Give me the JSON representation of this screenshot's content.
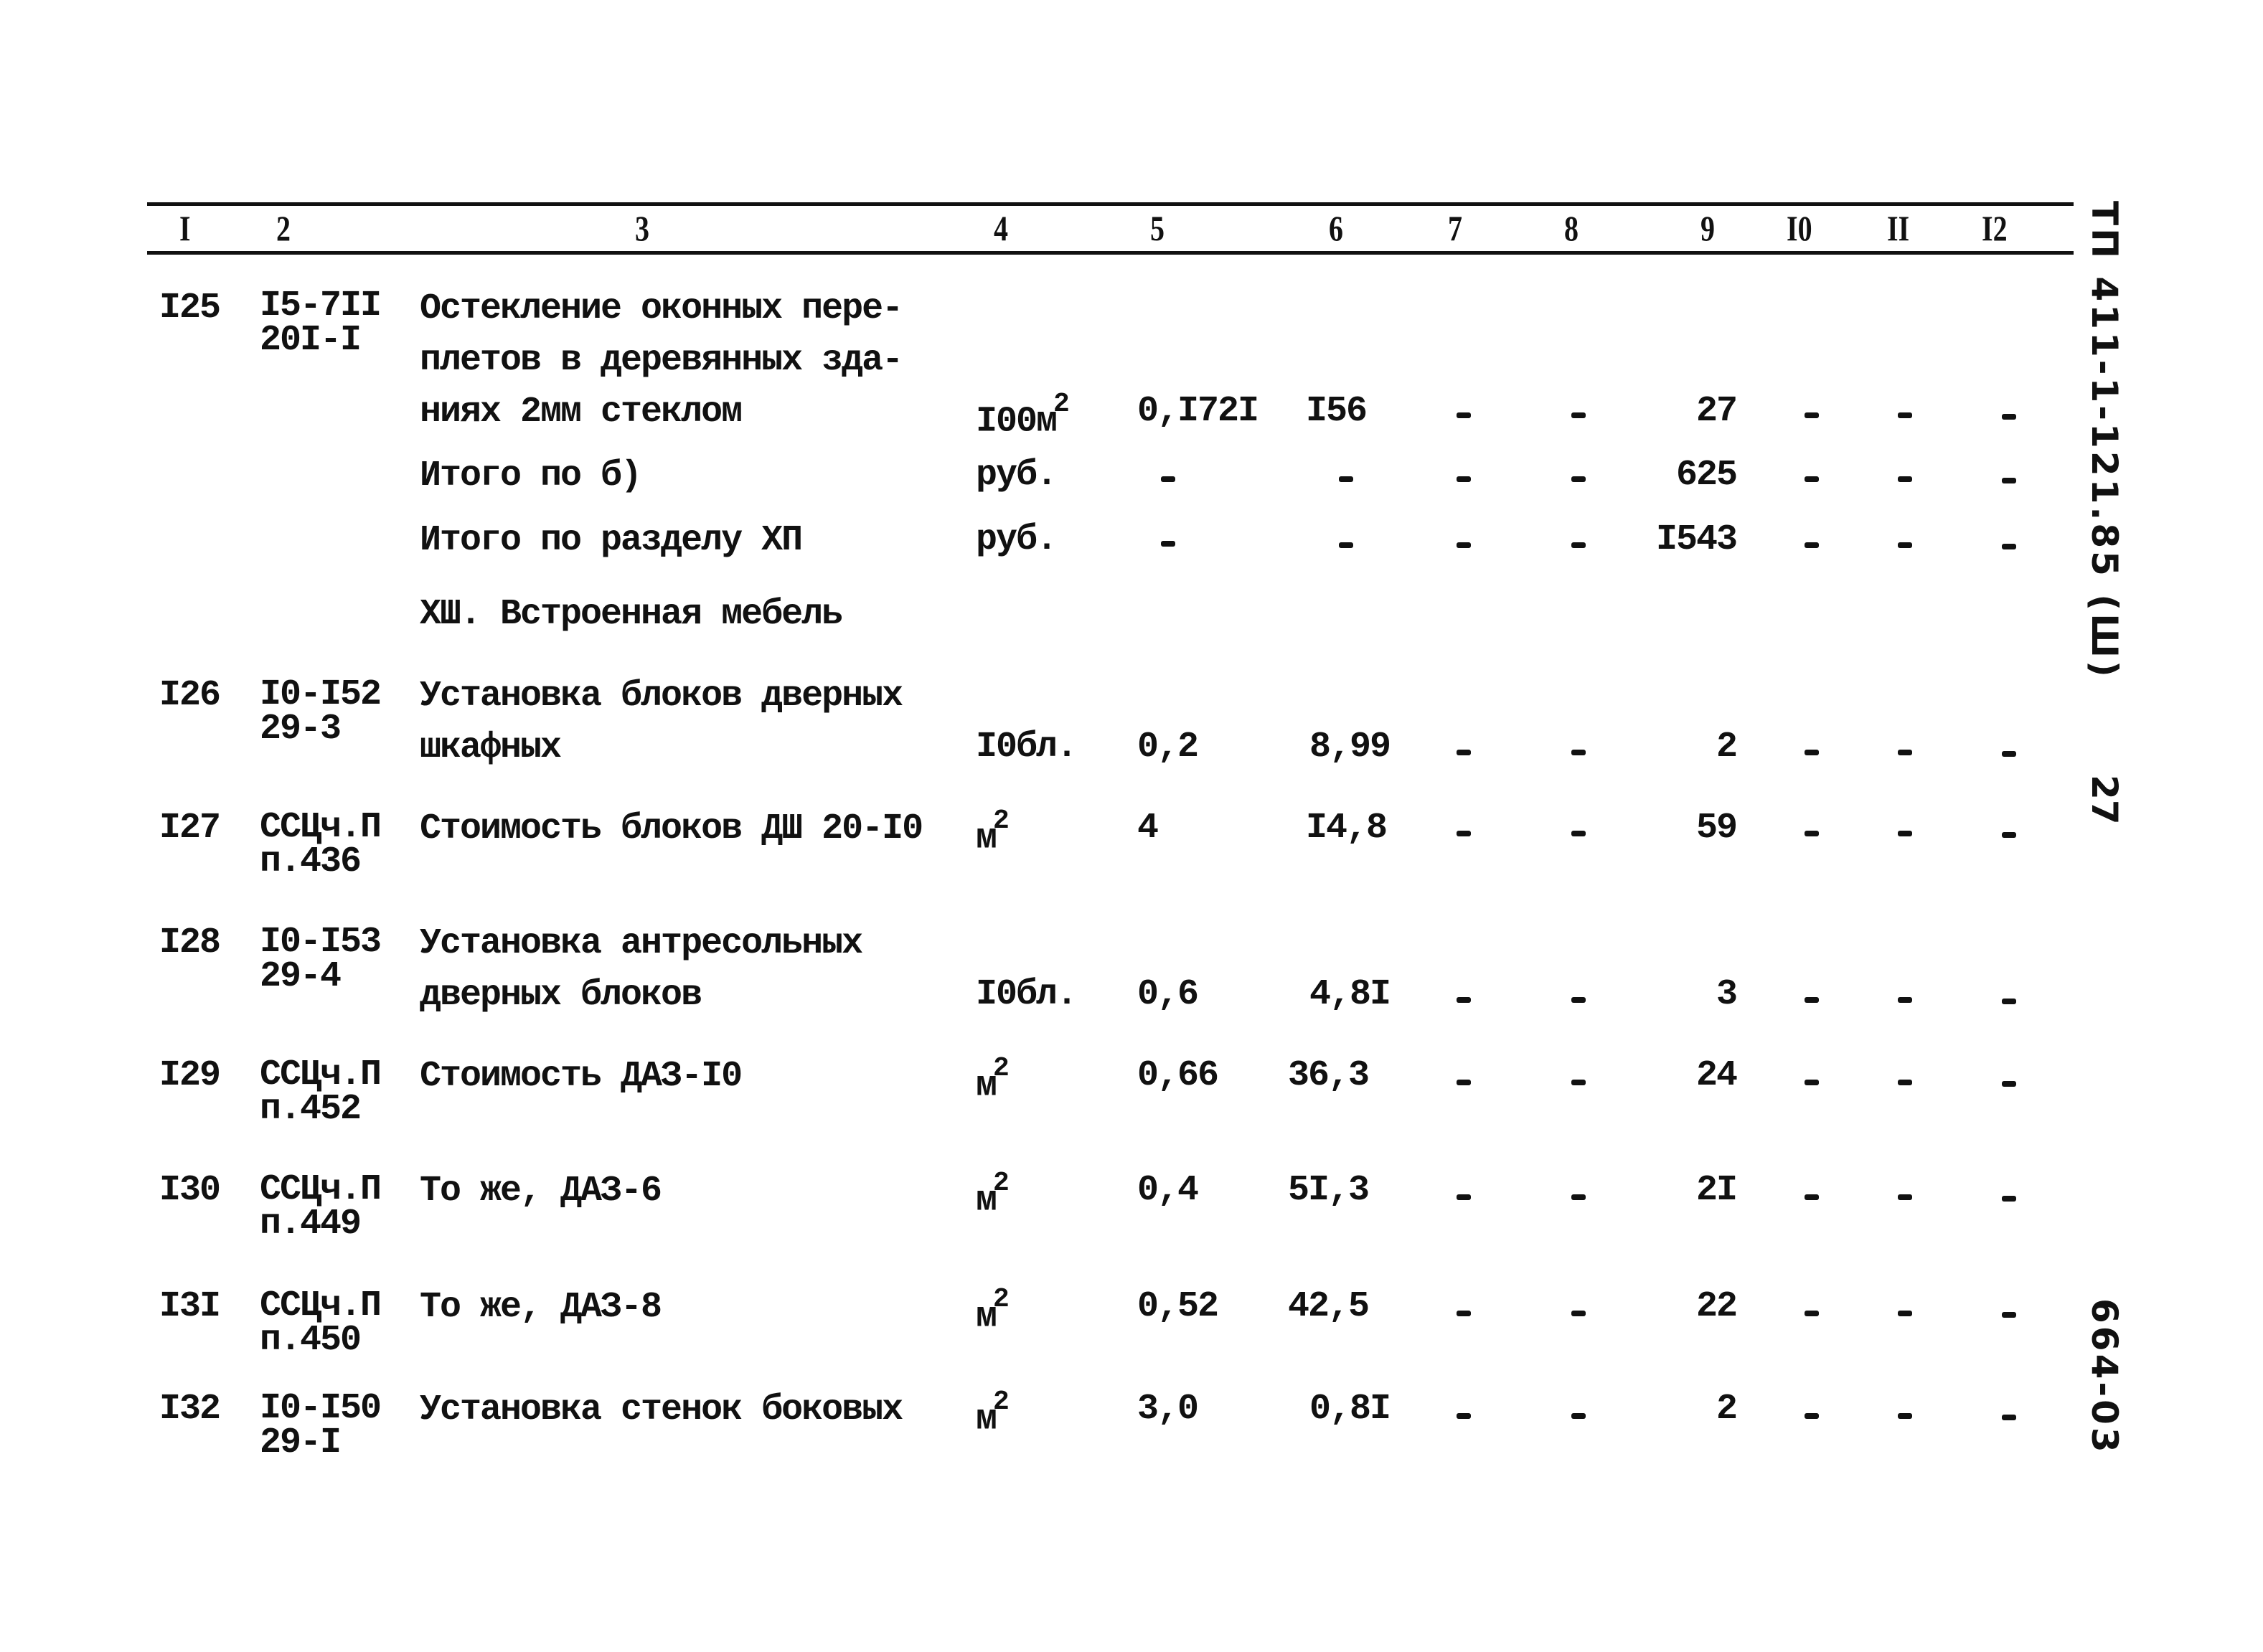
{
  "document": {
    "side_labels": {
      "doc_code": "ТП 411-1-121.85 (Ш)",
      "page_number": "27",
      "archive_code": "664-03"
    },
    "table": {
      "column_headers": [
        "I",
        "2",
        "3",
        "4",
        "5",
        "6",
        "7",
        "8",
        "9",
        "I0",
        "II",
        "I2"
      ],
      "rows": [
        {
          "num": "I25",
          "code_line1": "I5-7II",
          "code_line2": "20I-I",
          "description_lines": [
            "Остекление оконных пере-",
            "плетов в деревянных зда-",
            "ниях 2мм стеклом"
          ],
          "unit_base": "I00м",
          "unit_sup": "2",
          "quantity": "0,I72I",
          "unit_price": "I56",
          "col7": "-",
          "col8": "-",
          "total": "27",
          "col10": "-",
          "col11": "-",
          "col12": "-"
        },
        {
          "num": "",
          "description_lines": [
            "Итого по б)"
          ],
          "unit_base": "руб.",
          "quantity": "-",
          "unit_price": "-",
          "col7": "-",
          "col8": "-",
          "total": "625",
          "col10": "-",
          "col11": "-",
          "col12": "-"
        },
        {
          "num": "",
          "description_lines": [
            "Итого по разделу ХП"
          ],
          "unit_base": "руб.",
          "quantity": "-",
          "unit_price": "-",
          "col7": "-",
          "col8": "-",
          "total": "I543",
          "col10": "-",
          "col11": "-",
          "col12": "-"
        }
      ],
      "section_title": "ХШ. Встроенная мебель",
      "section_rows": [
        {
          "num": "I26",
          "code_line1": "I0-I52",
          "code_line2": "29-3",
          "description_lines": [
            "Установка блоков дверных",
            "шкафных"
          ],
          "unit_base": "I0бл.",
          "quantity": "0,2",
          "unit_price": "8,99",
          "col7": "-",
          "col8": "-",
          "total": "2",
          "col10": "-",
          "col11": "-",
          "col12": "-"
        },
        {
          "num": "I27",
          "code_line1": "ССЦч.П",
          "code_line2": "п.436",
          "description_lines": [
            "Стоимость блоков ДШ 20-I0"
          ],
          "unit_base": "м",
          "unit_sup": "2",
          "quantity": "4",
          "unit_price": "I4,8",
          "col7": "-",
          "col8": "-",
          "total": "59",
          "col10": "-",
          "col11": "-",
          "col12": "-"
        },
        {
          "num": "I28",
          "code_line1": "I0-I53",
          "code_line2": "29-4",
          "description_lines": [
            "Установка антресольных",
            "дверных блоков"
          ],
          "unit_base": "I0бл.",
          "quantity": "0,6",
          "unit_price": "4,8I",
          "col7": "-",
          "col8": "-",
          "total": "3",
          "col10": "-",
          "col11": "-",
          "col12": "-"
        },
        {
          "num": "I29",
          "code_line1": "ССЦч.П",
          "code_line2": "п.452",
          "description_lines": [
            "Стоимость ДАЗ-I0"
          ],
          "unit_base": "м",
          "unit_sup": "2",
          "quantity": "0,66",
          "unit_price": "36,3",
          "col7": "-",
          "col8": "-",
          "total": "24",
          "col10": "-",
          "col11": "-",
          "col12": "-"
        },
        {
          "num": "I30",
          "code_line1": "ССЦч.П",
          "code_line2": "п.449",
          "description_lines": [
            "То же, ДАЗ-6"
          ],
          "unit_base": "м",
          "unit_sup": "2",
          "quantity": "0,4",
          "unit_price": "5I,3",
          "col7": "-",
          "col8": "-",
          "total": "2I",
          "col10": "-",
          "col11": "-",
          "col12": "-"
        },
        {
          "num": "I3I",
          "code_line1": "ССЦч.П",
          "code_line2": "п.450",
          "description_lines": [
            "То же, ДАЗ-8"
          ],
          "unit_base": "м",
          "unit_sup": "2",
          "quantity": "0,52",
          "unit_price": "42,5",
          "col7": "-",
          "col8": "-",
          "total": "22",
          "col10": "-",
          "col11": "-",
          "col12": "-"
        },
        {
          "num": "I32",
          "code_line1": "I0-I50",
          "code_line2": "29-I",
          "description_lines": [
            "Установка стенок боковых"
          ],
          "unit_base": "м",
          "unit_sup": "2",
          "quantity": "3,0",
          "unit_price": "0,8I",
          "col7": "-",
          "col8": "-",
          "total": "2",
          "col10": "-",
          "col11": "-",
          "col12": "-"
        }
      ]
    }
  }
}
